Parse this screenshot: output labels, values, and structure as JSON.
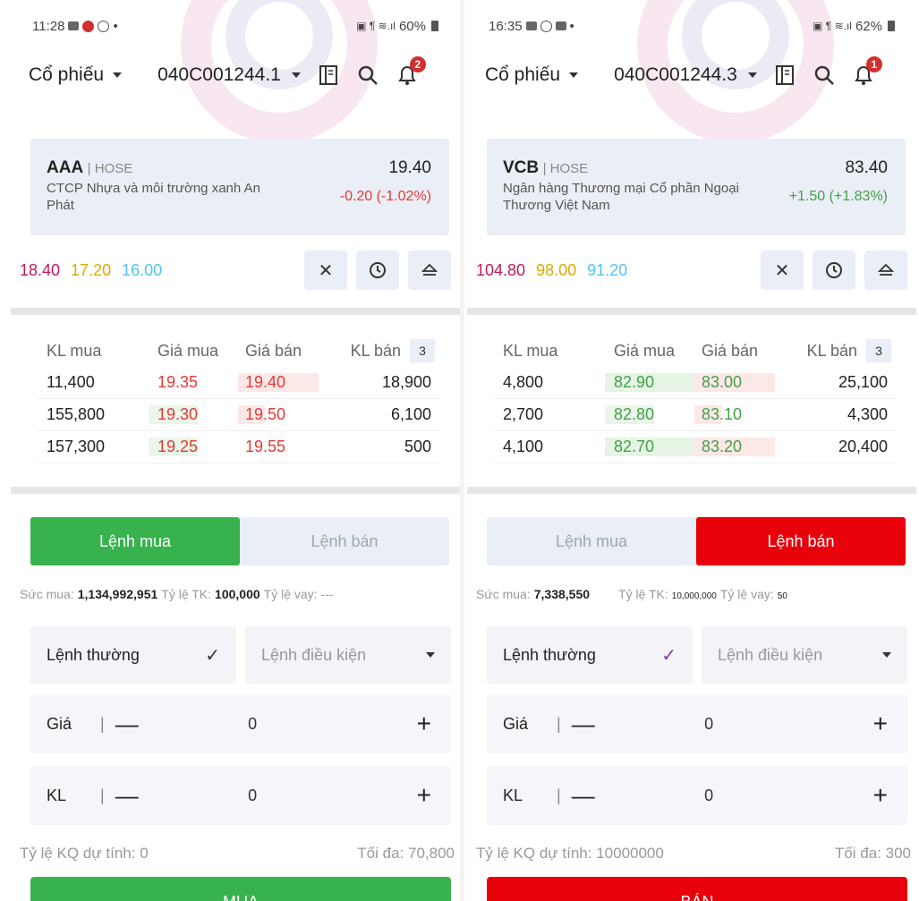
{
  "screens": [
    {
      "status": {
        "time": "11:28",
        "right": "60%"
      },
      "header": {
        "stock_type": "Cổ phiếu",
        "account": "040C001244.1",
        "notif_count": "2"
      },
      "stock": {
        "symbol": "AAA",
        "exchange": "| HOSE",
        "price": "19.40",
        "name": "CTCP Nhựa và môi trường xanh An Phát",
        "change": "-0.20 (-1.02%)",
        "change_color": "#e53935"
      },
      "ref": {
        "ceiling": "18.40",
        "reference": "17.20",
        "floor": "16.00"
      },
      "book": {
        "headers": [
          "KL mua",
          "Giá mua",
          "Giá bán",
          "KL bán"
        ],
        "depth": "3",
        "rows": [
          [
            "11,400",
            "19.35",
            "19.40",
            "18,900"
          ],
          [
            "155,800",
            "19.30",
            "19.50",
            "6,100"
          ],
          [
            "157,300",
            "19.25",
            "19.55",
            "500"
          ]
        ]
      },
      "tabs": {
        "buy": "Lệnh mua",
        "sell": "Lệnh bán",
        "active": "buy"
      },
      "power": {
        "label1": "Sức mua:",
        "val1": "1,134,992,951",
        "label2": "Tỷ lệ TK:",
        "val2": "100,000",
        "label3": "Tỷ lệ vay:",
        "val3": "---"
      },
      "order_type": {
        "normal": "Lệnh thường",
        "conditional": "Lệnh điều kiện"
      },
      "price_field": {
        "label": "Giá",
        "value": "0"
      },
      "qty_field": {
        "label": "KL",
        "value": "0"
      },
      "summary": {
        "ratio": "Tỷ lệ KQ dự tính: 0",
        "max": "Tối đa: 70,800"
      },
      "submit": "MUA"
    },
    {
      "status": {
        "time": "16:35",
        "right": "62%"
      },
      "header": {
        "stock_type": "Cổ phiếu",
        "account": "040C001244.3",
        "notif_count": "1"
      },
      "stock": {
        "symbol": "VCB",
        "exchange": "| HOSE",
        "price": "83.40",
        "name": "Ngân hàng Thương mại Cổ phần Ngoại Thương Việt Nam",
        "change": "+1.50 (+1.83%)",
        "change_color": "#43a047"
      },
      "ref": {
        "ceiling": "104.80",
        "reference": "98.00",
        "floor": "91.20"
      },
      "book": {
        "headers": [
          "KL mua",
          "Giá mua",
          "Giá bán",
          "KL bán"
        ],
        "depth": "3",
        "rows": [
          [
            "4,800",
            "82.90",
            "83.00",
            "25,100"
          ],
          [
            "2,700",
            "82.80",
            "83.10",
            "4,300"
          ],
          [
            "4,100",
            "82.70",
            "83.20",
            "20,400"
          ]
        ]
      },
      "tabs": {
        "buy": "Lệnh mua",
        "sell": "Lệnh bán",
        "active": "sell"
      },
      "power": {
        "label1": "Sức mua:",
        "val1": "7,338,550",
        "label2": "Tỷ lệ TK:",
        "val2": "10,000,000",
        "label3": "Tỷ lệ vay:",
        "val3": "50"
      },
      "order_type": {
        "normal": "Lệnh thường",
        "conditional": "Lệnh điều kiện"
      },
      "price_field": {
        "label": "Giá",
        "value": "0"
      },
      "qty_field": {
        "label": "KL",
        "value": "0"
      },
      "summary": {
        "ratio": "Tỷ lệ KQ dự tính: 10000000",
        "max": "Tối đa: 300"
      },
      "submit": "BÁN"
    }
  ]
}
